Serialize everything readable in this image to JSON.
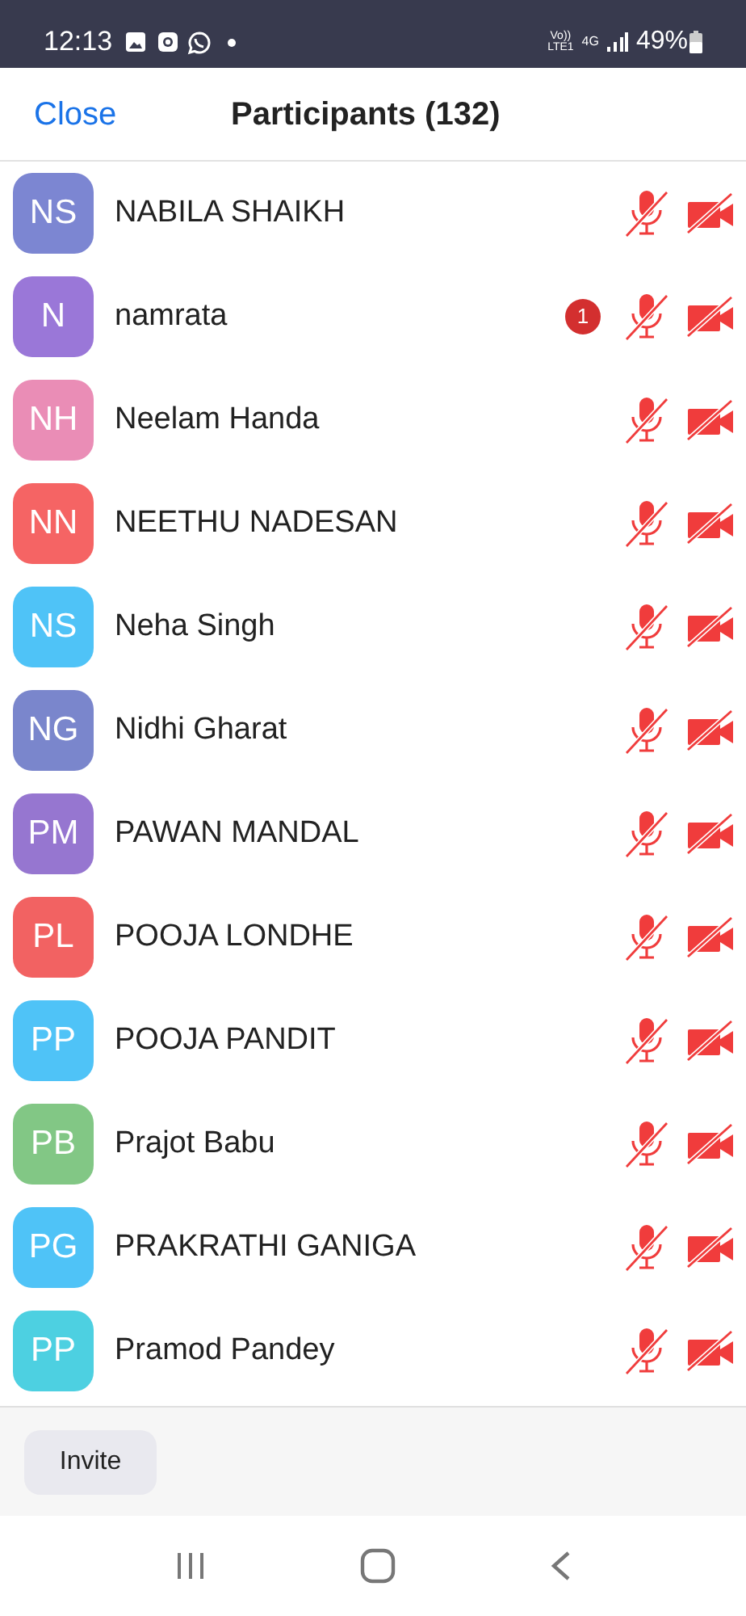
{
  "status_bar": {
    "time": "12:13",
    "volte_top": "Vo))",
    "volte_bottom": "LTE1",
    "network": "4G",
    "battery": "49%"
  },
  "header": {
    "close": "Close",
    "title": "Participants (132)"
  },
  "participants": [
    {
      "initials": "NS",
      "name": "NABILA SHAIKH",
      "color": "#7c86d2",
      "muted": true,
      "video_off": true
    },
    {
      "initials": "N",
      "name": "namrata",
      "color": "#9a77d8",
      "muted": true,
      "video_off": true,
      "badge": "1"
    },
    {
      "initials": "NH",
      "name": "Neelam Handa",
      "color": "#ea8db6",
      "muted": true,
      "video_off": true
    },
    {
      "initials": "NN",
      "name": "NEETHU NADESAN",
      "color": "#f56464",
      "muted": true,
      "video_off": true
    },
    {
      "initials": "NS",
      "name": "Neha Singh",
      "color": "#4fc3f7",
      "muted": true,
      "video_off": true
    },
    {
      "initials": "NG",
      "name": "Nidhi Gharat",
      "color": "#7a86cc",
      "muted": true,
      "video_off": true
    },
    {
      "initials": "PM",
      "name": "PAWAN MANDAL",
      "color": "#9676d0",
      "muted": true,
      "video_off": true
    },
    {
      "initials": "PL",
      "name": "POOJA LONDHE",
      "color": "#f26262",
      "muted": true,
      "video_off": true
    },
    {
      "initials": "PP",
      "name": "POOJA PANDIT",
      "color": "#4fc3f7",
      "muted": true,
      "video_off": true
    },
    {
      "initials": "PB",
      "name": "Prajot Babu",
      "color": "#82c785",
      "muted": true,
      "video_off": true
    },
    {
      "initials": "PG",
      "name": "PRAKRATHI GANIGA",
      "color": "#4fc3f7",
      "muted": true,
      "video_off": true
    },
    {
      "initials": "PP",
      "name": "Pramod Pandey",
      "color": "#4dd0e1",
      "muted": true,
      "video_off": true
    }
  ],
  "footer": {
    "invite": "Invite"
  }
}
